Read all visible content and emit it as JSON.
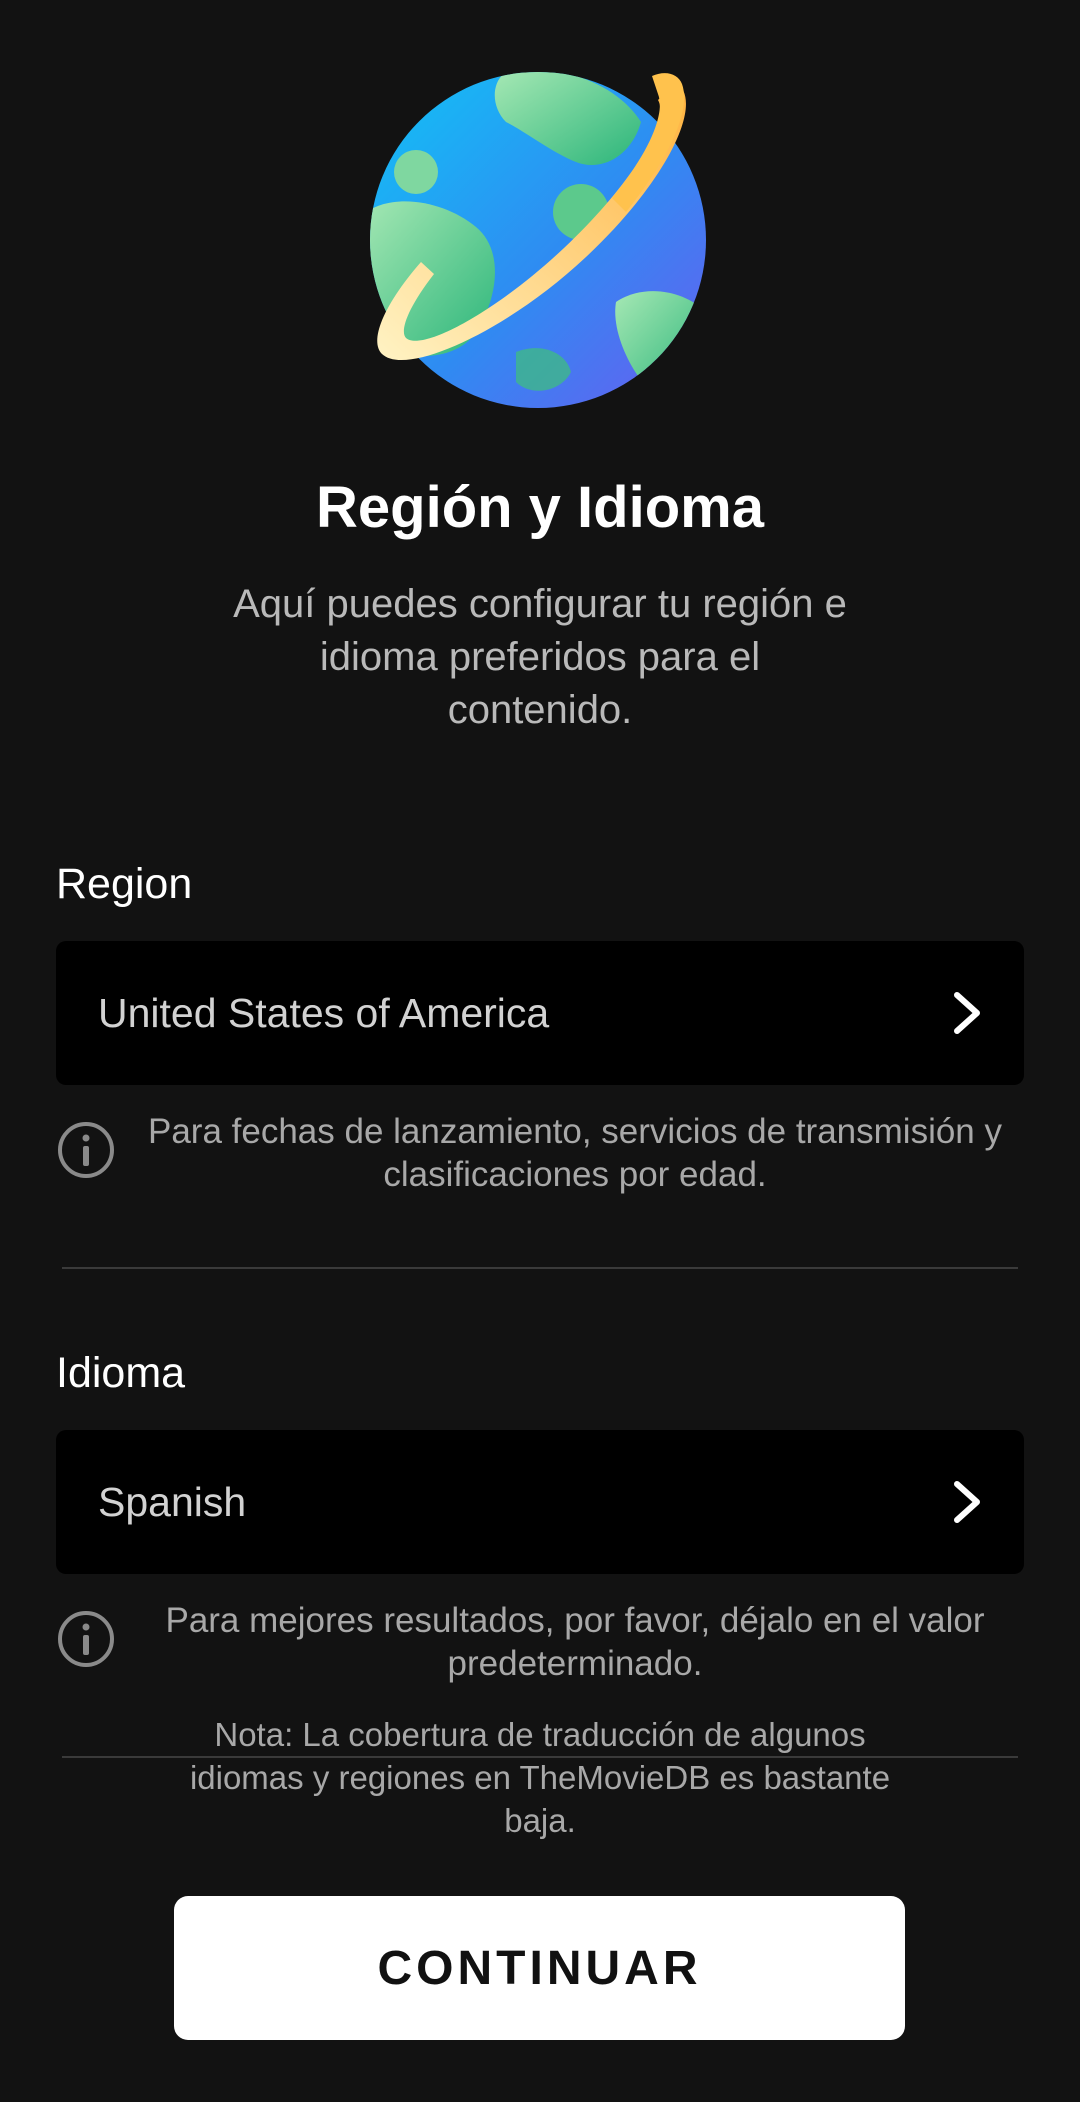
{
  "header": {
    "title": "Región y Idioma",
    "subtitle": "Aquí puedes configurar tu región e idioma preferidos para el contenido.",
    "icon": "globe-planet-icon"
  },
  "region": {
    "label": "Region",
    "value": "United States of America",
    "hint": "Para fechas de lanzamiento, servicios de transmisión y clasificaciones por edad."
  },
  "language": {
    "label": "Idioma",
    "value": "Spanish",
    "hint": "Para mejores resultados, por favor, déjalo en el valor predeterminado."
  },
  "note": "Nota: La cobertura de traducción de algunos idiomas y regiones en TheMovieDB es bastante baja.",
  "actions": {
    "continue_label": "CONTINUAR"
  },
  "colors": {
    "background": "#121212",
    "selector_background": "#000000",
    "primary_text": "#ffffff",
    "secondary_text": "#a8a8a8",
    "button_background": "#ffffff",
    "button_text": "#111111"
  }
}
